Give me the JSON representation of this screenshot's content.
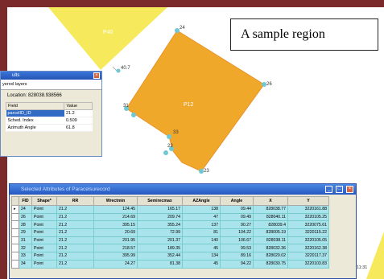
{
  "annotation": {
    "text": "A sample region"
  },
  "map": {
    "polygon_label": "P12",
    "triangle_label": "P40",
    "point_labels": [
      "24",
      "40.7",
      "26",
      "31",
      "33",
      "23",
      "22",
      "23"
    ],
    "colors": {
      "region_orange": "#f0a82a",
      "triangle_yellow": "#f6ea5c",
      "vertex_cyan": "#6fc8d4"
    }
  },
  "identify_window": {
    "title": "ults",
    "layers_label": "yerxxl layers",
    "location_label": "Location:",
    "location_value": "828038.938566",
    "columns": [
      "Field",
      "Value"
    ],
    "rows": [
      {
        "field": "parcelID_ID",
        "value": "21.2"
      },
      {
        "field": "Sched. Index",
        "value": "0.509"
      },
      {
        "field": "Azimuth Angle",
        "value": "61.8"
      }
    ]
  },
  "table_window": {
    "title": "Selected Attributes of Paracelsurecord",
    "columns": [
      "FID",
      "Shape*",
      "RR",
      "Wrectmin",
      "Semirecmax",
      "AZAngle",
      "Angle",
      "X",
      "Y"
    ],
    "rows": [
      [
        "24",
        "Point",
        "21.2",
        "124.45",
        "165.17",
        "138",
        "09.44",
        "828038.77",
        "3220161.88"
      ],
      [
        "26",
        "Point",
        "21.2",
        "214.69",
        "209.74",
        "47",
        "09.49",
        "828040.11",
        "3220105.25"
      ],
      [
        "28",
        "Point",
        "21.2",
        "395.15",
        "355.24",
        "137",
        "90.27",
        "828039.4",
        "3220075.61"
      ],
      [
        "29",
        "Point",
        "21.2",
        "20.69",
        "72.99",
        "81",
        "104.22",
        "828005.19",
        "3220115.22"
      ],
      [
        "31",
        "Point",
        "21.2",
        "201.95",
        "201.37",
        "140",
        "106.67",
        "828038.11",
        "3220105.05"
      ],
      [
        "32",
        "Point",
        "21.2",
        "218.57",
        "189.35",
        "45",
        "99.53",
        "828032.36",
        "3220162.38"
      ],
      [
        "33",
        "Point",
        "21.2",
        "395.99",
        "352.44",
        "134",
        "89.16",
        "828029.02",
        "3220117.37"
      ],
      [
        "34",
        "Point",
        "21.2",
        "24.27",
        "81.38",
        "45",
        "94.22",
        "828030.75",
        "3220103.83"
      ]
    ]
  },
  "taskbar": {
    "time": "11:31"
  }
}
